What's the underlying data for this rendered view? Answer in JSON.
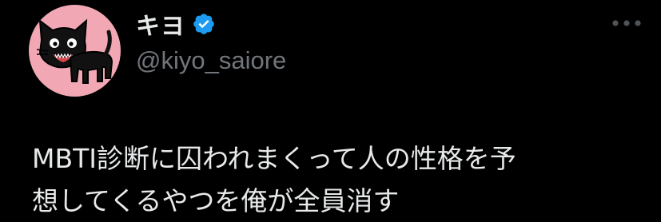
{
  "tweet": {
    "author": {
      "display_name": "キヨ",
      "handle": "@kiyo_saiore",
      "verified": true,
      "avatar_icon": "black-cat-avatar-icon",
      "verified_icon": "verified-badge-icon"
    },
    "more_icon": "more-options-icon",
    "text_lines": [
      "MBTI診断に囚われまくって人の性格を予",
      "想してくるやつを俺が全員消す"
    ]
  },
  "colors": {
    "background": "#000000",
    "text_primary": "#e7e9ea",
    "text_secondary": "#71767b",
    "verified_blue": "#1d9bf0",
    "avatar_bg": "#f2a8b4",
    "more_icon": "#505459"
  }
}
